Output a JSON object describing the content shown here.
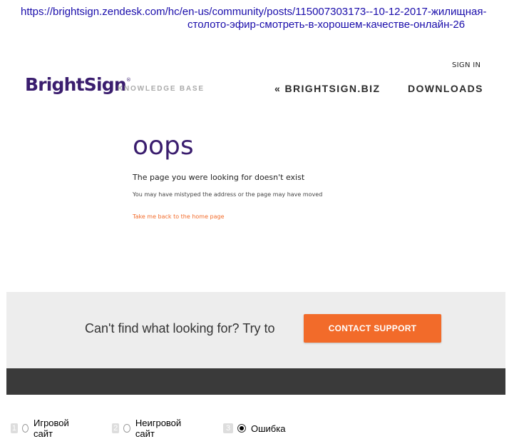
{
  "url": {
    "line1": "https://brightsign.zendesk.com/hc/en-us/community/posts/115007303173--10-12-2017-жилищная-",
    "line2": "столото-эфир-смотреть-в-хорошем-качестве-онлайн-26"
  },
  "header": {
    "sign_in": "SIGN IN",
    "logo": "BrightSign",
    "logo_mark": "®",
    "kb_label": "KNOWLEDGE BASE",
    "nav_biz": "« BRIGHTSIGN.BIZ",
    "nav_downloads": "DOWNLOADS"
  },
  "error": {
    "title": "oops",
    "message": "The page you were looking for doesn't exist",
    "sub_message": "You may have mistyped the address or the page may have moved",
    "home_link": "Take me back to the home page"
  },
  "support": {
    "prompt": "Can't find what looking for? Try to",
    "button": "CONTACT SUPPORT"
  },
  "options": [
    {
      "num": "1",
      "label": "Игровой сайт",
      "checked": false
    },
    {
      "num": "2",
      "label": "Неигровой сайт",
      "checked": false
    },
    {
      "num": "3",
      "label": "Ошибка",
      "checked": true
    }
  ],
  "colors": {
    "brand_purple": "#3a1d6e",
    "accent_orange": "#f26b2a",
    "band_gray": "#ededed",
    "footer_dark": "#3a3a3a"
  }
}
